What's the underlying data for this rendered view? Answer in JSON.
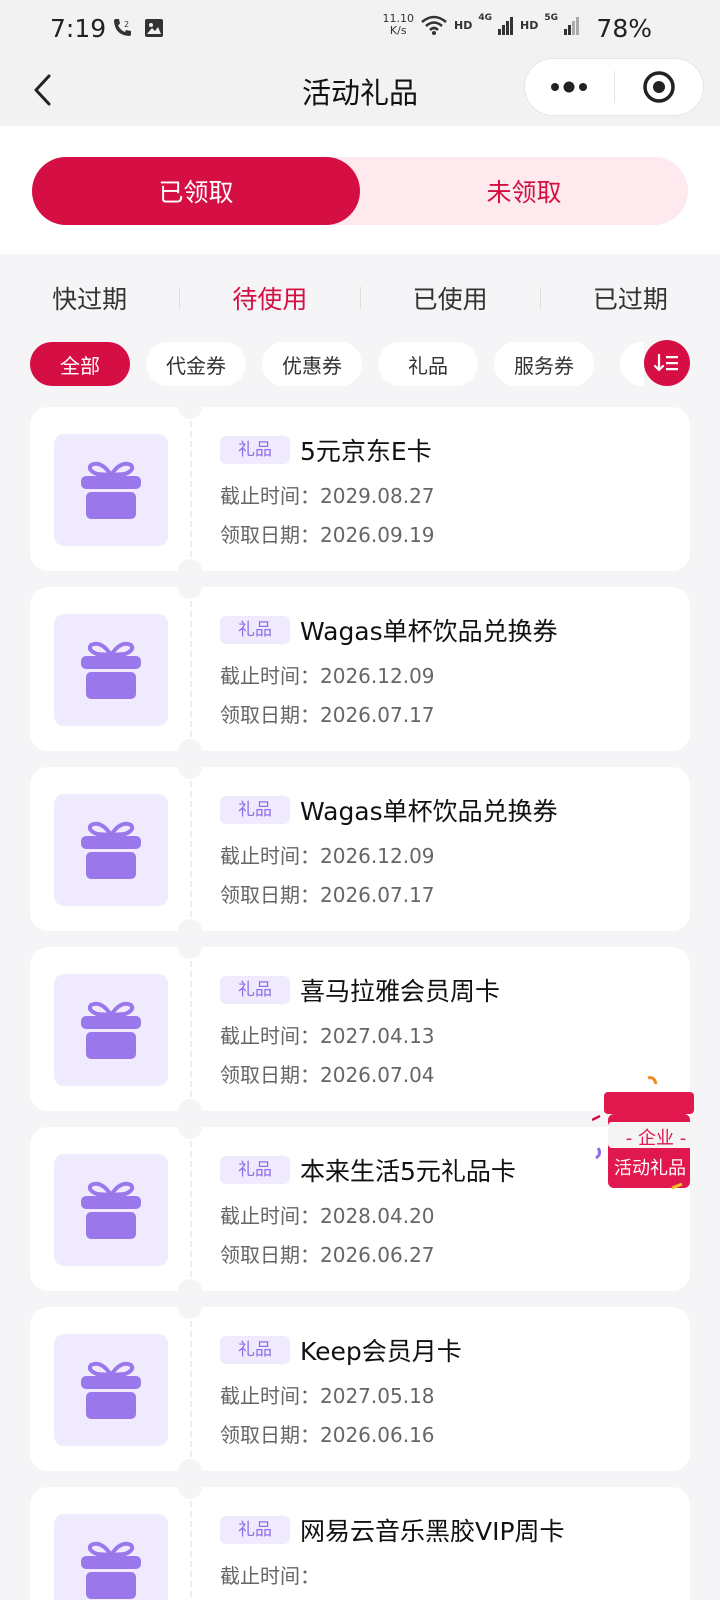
{
  "status_bar": {
    "time": "7:19",
    "net_speed_value": "11.10",
    "net_speed_unit": "K/s",
    "hd1": "HD",
    "net1": "4G",
    "hd2": "HD",
    "net2": "5G",
    "battery": "78%"
  },
  "header": {
    "title": "活动礼品"
  },
  "toggle": {
    "received": "已领取",
    "not_received": "未领取"
  },
  "status_tabs": [
    {
      "label": "快过期"
    },
    {
      "label": "待使用"
    },
    {
      "label": "已使用"
    },
    {
      "label": "已过期"
    }
  ],
  "active_status_tab": "待使用",
  "chips": [
    {
      "label": "全部"
    },
    {
      "label": "代金券"
    },
    {
      "label": "优惠券"
    },
    {
      "label": "礼品"
    },
    {
      "label": "服务券"
    }
  ],
  "active_chip": "全部",
  "cards": [
    {
      "tag": "礼品",
      "name": "5元京东E卡",
      "expire_label": "截止时间：",
      "expire": "2029.08.27",
      "receive_label": "领取日期：",
      "receive": "2026.09.19"
    },
    {
      "tag": "礼品",
      "name": "Wagas单杯饮品兑换券",
      "expire_label": "截止时间：",
      "expire": "2026.12.09",
      "receive_label": "领取日期：",
      "receive": "2026.07.17"
    },
    {
      "tag": "礼品",
      "name": "Wagas单杯饮品兑换券",
      "expire_label": "截止时间：",
      "expire": "2026.12.09",
      "receive_label": "领取日期：",
      "receive": "2026.07.17"
    },
    {
      "tag": "礼品",
      "name": "喜马拉雅会员周卡",
      "expire_label": "截止时间：",
      "expire": "2027.04.13",
      "receive_label": "领取日期：",
      "receive": "2026.07.04"
    },
    {
      "tag": "礼品",
      "name": "本来生活5元礼品卡",
      "expire_label": "截止时间：",
      "expire": "2028.04.20",
      "receive_label": "领取日期：",
      "receive": "2026.06.27"
    },
    {
      "tag": "礼品",
      "name": "Keep会员月卡",
      "expire_label": "截止时间：",
      "expire": "2027.05.18",
      "receive_label": "领取日期：",
      "receive": "2026.06.16"
    },
    {
      "tag": "礼品",
      "name": "网易云音乐黑胶VIP周卡",
      "expire_label": "截止时间：",
      "expire": "",
      "receive_label": "",
      "receive": ""
    }
  ],
  "float_badge": {
    "line1": "- 企业 -",
    "line2": "活动礼品"
  },
  "colors": {
    "accent": "#d50f43",
    "accent_light": "#fde9ee",
    "gift_bg": "#efeafe",
    "gift_icon": "#9a77ea",
    "page_bg": "#f5f5f7"
  },
  "icons": {
    "back": "chevron-left-icon",
    "more": "more-dots-icon",
    "target": "target-icon",
    "sort": "sort-icon",
    "gift": "gift-icon"
  }
}
